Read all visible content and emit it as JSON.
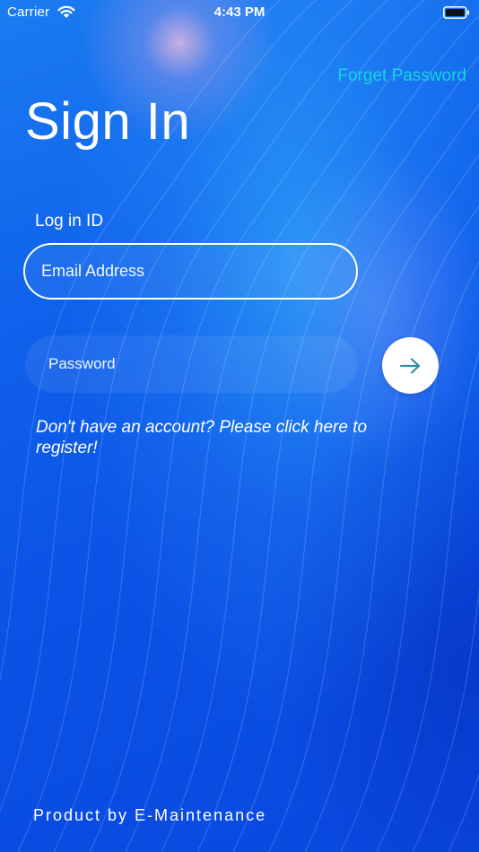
{
  "status_bar": {
    "carrier": "Carrier",
    "time": "4:43 PM",
    "wifi_icon": "wifi-icon",
    "battery_icon": "battery-icon"
  },
  "header": {
    "title": "Sign In",
    "forget_password_label": "Forget Password"
  },
  "form": {
    "login_id_label": "Log in ID",
    "email": {
      "value": "",
      "placeholder": "Email Address"
    },
    "password": {
      "value": "",
      "placeholder": "Password"
    },
    "submit_icon": "arrow-right-icon",
    "register_text": "Don't have an account? Please click here to register!"
  },
  "footer": {
    "product_text": "Product by E-Maintenance"
  },
  "colors": {
    "background": "#0b57e8",
    "link": "#19d3e2",
    "arrow": "#2b8fa6",
    "text": "#ffffff"
  }
}
